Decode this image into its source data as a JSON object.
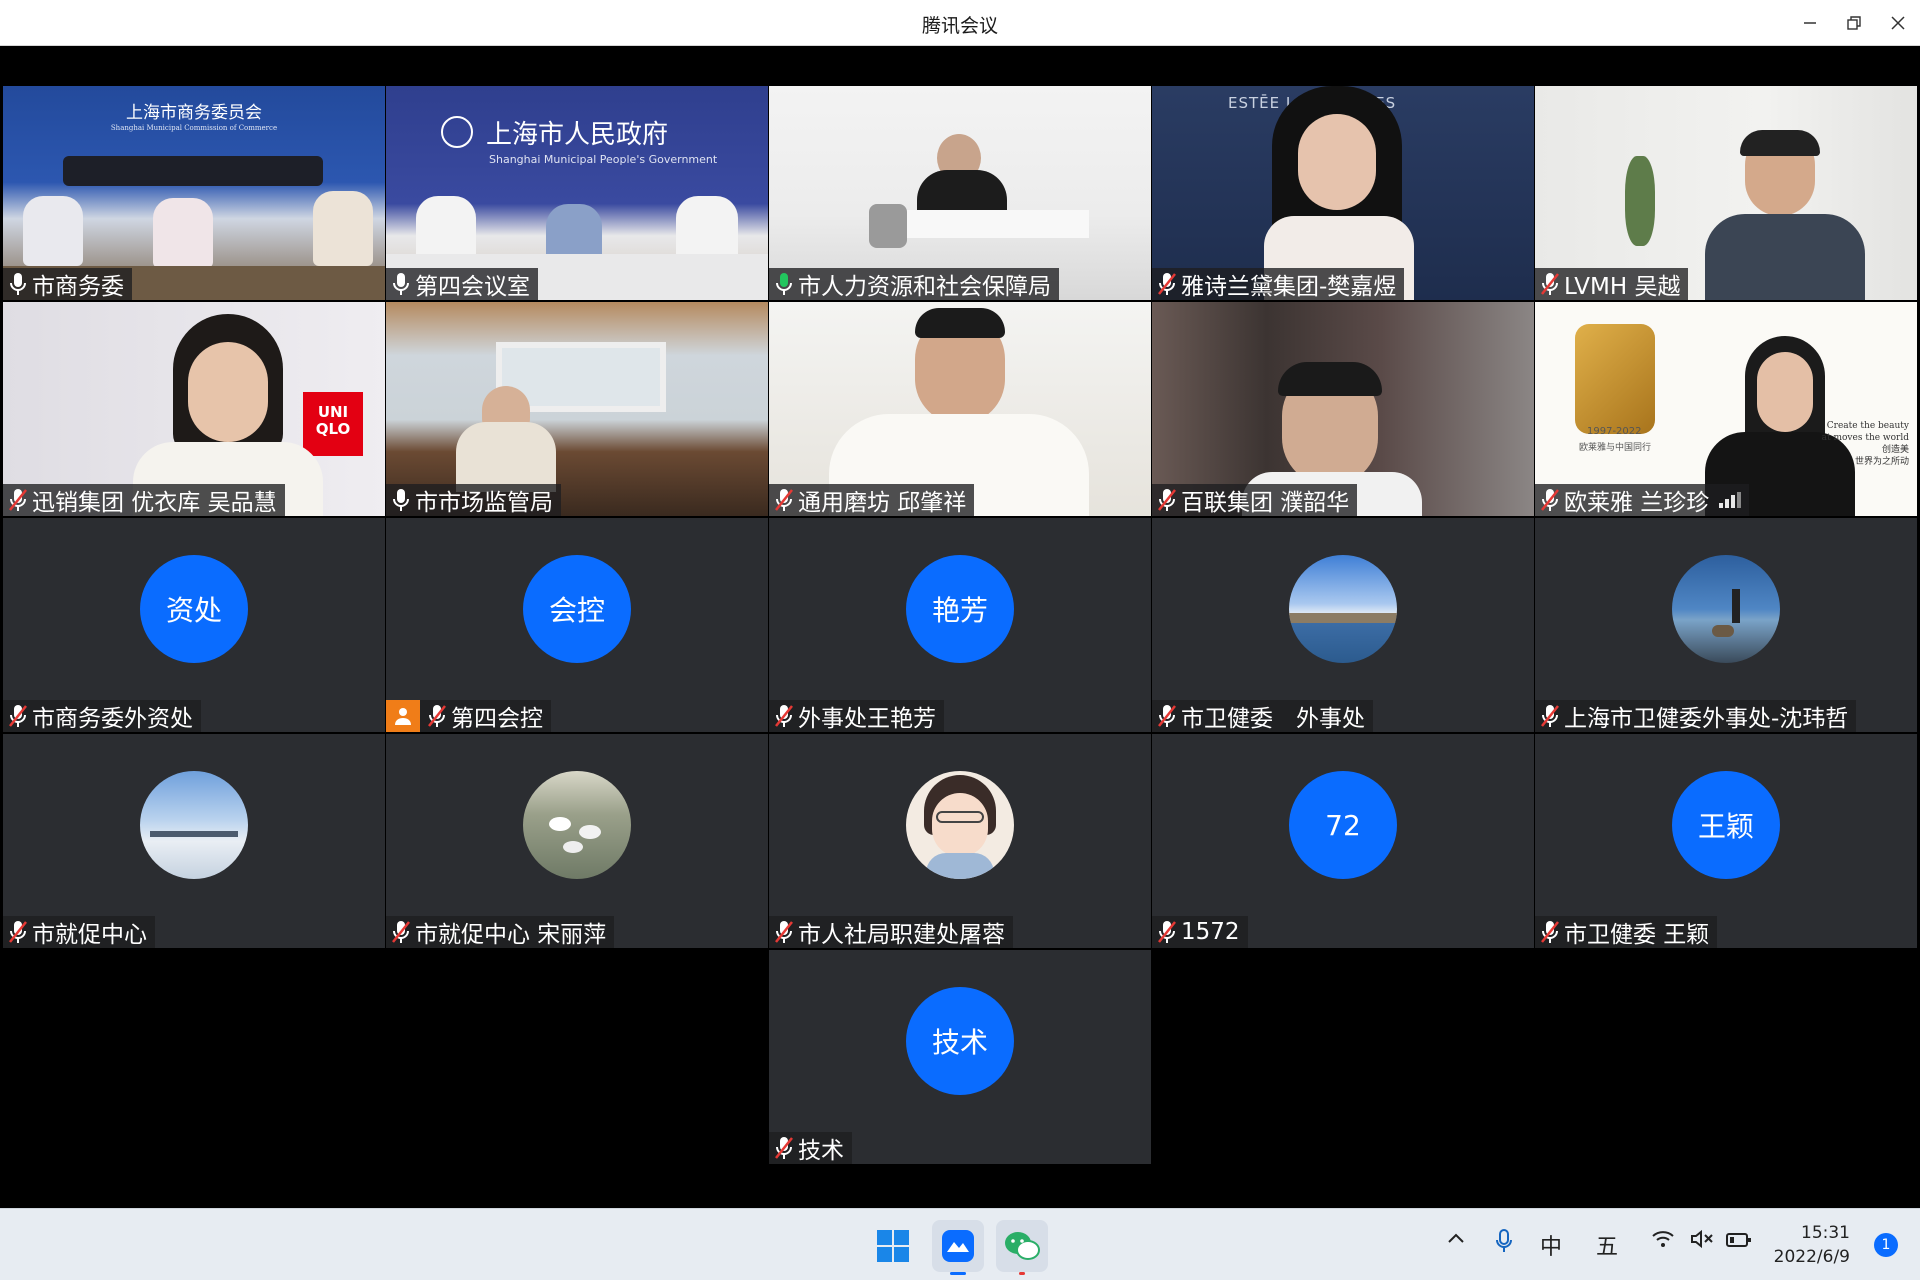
{
  "window": {
    "title": "腾讯会议"
  },
  "participants": [
    {
      "name": "市商务委",
      "mic": "on",
      "video": true
    },
    {
      "name": "第四会议室",
      "mic": "on",
      "video": true
    },
    {
      "name": "市人力资源和社会保障局",
      "mic": "speaking",
      "video": true
    },
    {
      "name": "雅诗兰黛集团-樊嘉煜",
      "mic": "muted",
      "video": true
    },
    {
      "name": "LVMH 吴越",
      "mic": "muted",
      "video": true
    },
    {
      "name": "迅销集团 优衣库 吴品慧",
      "mic": "muted",
      "video": true
    },
    {
      "name": "市市场监管局",
      "mic": "on",
      "video": true
    },
    {
      "name": "通用磨坊 邱肇祥",
      "mic": "muted",
      "video": true
    },
    {
      "name": "百联集团 濮韶华",
      "mic": "muted",
      "video": true
    },
    {
      "name": "欧莱雅 兰珍珍",
      "mic": "muted",
      "video": true,
      "signal": true
    },
    {
      "name": "市商务委外资处",
      "mic": "muted",
      "avatar_text": "资处"
    },
    {
      "name": "第四会控",
      "mic": "muted",
      "avatar_text": "会控",
      "host": true
    },
    {
      "name": "外事处王艳芳",
      "mic": "muted",
      "avatar_text": "艳芳"
    },
    {
      "name": "市卫健委　外事处",
      "mic": "muted",
      "avatar_image": "lake-landscape"
    },
    {
      "name": "上海市卫健委外事处-沈玮哲",
      "mic": "muted",
      "avatar_image": "beach-person"
    },
    {
      "name": "市就促中心",
      "mic": "muted",
      "avatar_image": "snow-harbor"
    },
    {
      "name": "市就促中心 宋丽萍",
      "mic": "muted",
      "avatar_image": "geese-water"
    },
    {
      "name": "市人社局职建处屠蓉",
      "mic": "muted",
      "avatar_image": "cartoon-woman"
    },
    {
      "name": "1572",
      "mic": "muted",
      "avatar_text": "72"
    },
    {
      "name": "市卫健委 王颖",
      "mic": "muted",
      "avatar_text": "王颖"
    },
    {
      "name": "技术",
      "mic": "muted",
      "avatar_text": "技术"
    }
  ],
  "video_text": {
    "sign_commerce_cn": "上海市商务委员会",
    "sign_commerce_en": "Shanghai Municipal Commission of Commerce",
    "sign_gov_cn": "上海市人民政府",
    "sign_gov_en": "Shanghai Municipal People's Government",
    "estee_backdrop": "ESTĒE LAUD      PANIES",
    "uniqlo_logo": "UNI QLO",
    "loreal_years": "1997-2022",
    "loreal_cn": "欧莱雅与中国同行",
    "loreal_en1": "Create the beauty",
    "loreal_en2": "at moves the world",
    "loreal_cn2": "创造美",
    "loreal_cn3": "世界为之所动"
  },
  "taskbar": {
    "tray": {
      "ime1": "中",
      "ime2": "五",
      "time": "15:31",
      "date": "2022/6/9",
      "notifications": "1"
    }
  },
  "colors": {
    "avatar_blue": "#0a6cff",
    "tile_bg": "#2b2d31",
    "host_orange": "#f07d18",
    "speaking_green": "#22c55e"
  }
}
